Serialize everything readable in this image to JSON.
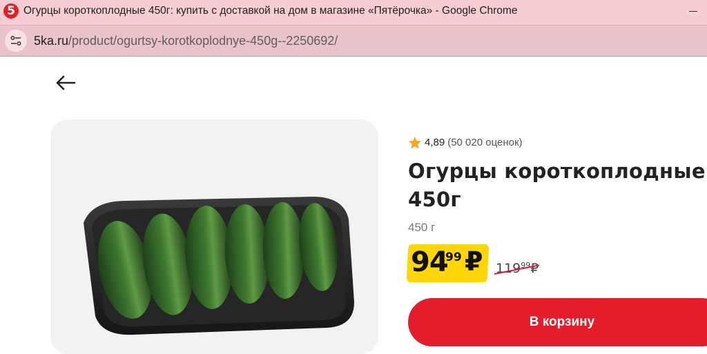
{
  "browser": {
    "window_title": "Огурцы короткоплодные 450г: купить с доставкой на дом в магазине «Пятёрочка» - Google Chrome",
    "favicon_text": "5",
    "url_host": "5ka.ru",
    "url_path": "/product/ogurtsy-korotkoplodnye-450g--2250692/"
  },
  "product": {
    "rating": "4,89",
    "rating_count": "(50 020 оценок)",
    "title": "Огурцы короткоплодные 450г",
    "weight": "450 г",
    "price_main": "94",
    "price_kopecks": "99",
    "currency": "₽",
    "old_price_main": "119",
    "old_price_kopecks": "99",
    "old_currency": "₽",
    "add_to_cart_label": "В корзину"
  },
  "colors": {
    "accent_red": "#e41d2c",
    "price_badge_yellow": "#ffd60a",
    "star": "#f5a623",
    "titlebar": "#f6cdd3"
  },
  "icons": {
    "back": "arrow-left-icon",
    "star": "star-icon",
    "site_info": "tune-icon"
  }
}
